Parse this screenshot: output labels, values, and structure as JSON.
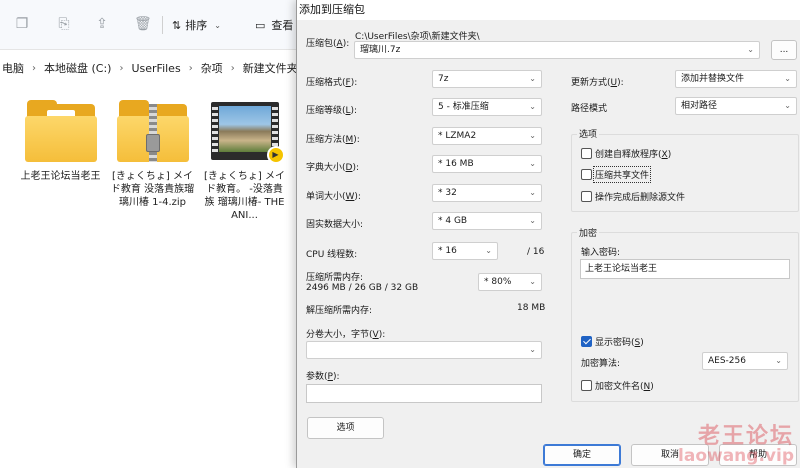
{
  "explorer": {
    "toolbar": {
      "sort_label": "排序",
      "view_label": "查看"
    },
    "breadcrumb": [
      "电脑",
      "本地磁盘 (C:)",
      "UserFiles",
      "杂项",
      "新建文件夹"
    ],
    "files": [
      {
        "name": "上老王论坛当老王",
        "icon": "folder-icon"
      },
      {
        "name": "[きょくちょ] メイド教育 没落貴族瑠璃川椿 1-4.zip",
        "icon": "zip-folder-icon"
      },
      {
        "name": "[きょくちょ] メイド教育。 -没落貴族 瑠璃川椿- THE ANI...",
        "icon": "video-file-icon"
      }
    ]
  },
  "dialog": {
    "title": "添加到压缩包",
    "archive": {
      "label": "压缩包(",
      "label_key": "A",
      "label_end": "):",
      "path": "C:\\UserFiles\\杂项\\新建文件夹\\",
      "name": "瑠璃川.7z",
      "browse_label": "..."
    },
    "left": {
      "format": {
        "label": "压缩格式(",
        "key": "F",
        "end": "):",
        "value": "7z"
      },
      "level": {
        "label": "压缩等级(",
        "key": "L",
        "end": "):",
        "value": "5 - 标准压缩"
      },
      "method": {
        "label": "压缩方法(",
        "key": "M",
        "end": "):",
        "value": "*  LZMA2"
      },
      "dict": {
        "label": "字典大小(",
        "key": "D",
        "end": "):",
        "value": "*  16 MB"
      },
      "word": {
        "label": "单词大小(",
        "key": "W",
        "end": "):",
        "value": "*  32"
      },
      "solid": {
        "label": "固实数据大小:",
        "value": "*  4 GB"
      },
      "threads": {
        "label": "CPU 线程数:",
        "value": "*  16",
        "max": "/ 16"
      },
      "memory": {
        "label": "压缩所需内存:",
        "detail": "2496 MB / 26 GB / 32 GB",
        "value": "* 80%"
      },
      "decomp": {
        "label": "解压缩所需内存:",
        "value": "18 MB"
      },
      "split": {
        "label": "分卷大小，字节(",
        "key": "V",
        "end": "):",
        "value": ""
      },
      "params": {
        "label": "参数(",
        "key": "P",
        "end": "):",
        "value": ""
      },
      "options_button": "选项"
    },
    "right": {
      "update_mode": {
        "label": "更新方式(",
        "key": "U",
        "end": "):",
        "value": "添加并替换文件"
      },
      "path_mode": {
        "label": "路径模式",
        "value": "相对路径"
      },
      "options_group": {
        "title": "选项",
        "sfx": {
          "label": "创建自释放程序(",
          "key": "X",
          "end": ")",
          "checked": false
        },
        "shared": {
          "label": "压缩共享文件",
          "checked": false
        },
        "delete": {
          "label": "操作完成后删除源文件",
          "checked": false
        }
      },
      "encryption_group": {
        "title": "加密",
        "password_label": "输入密码:",
        "password": "上老王论坛当老王",
        "show_password": {
          "label": "显示密码(",
          "key": "S",
          "end": ")",
          "checked": true
        },
        "method_label": "加密算法:",
        "method_value": "AES-256",
        "encrypt_names": {
          "label": "加密文件名(",
          "key": "N",
          "end": ")",
          "checked": false
        }
      }
    },
    "buttons": {
      "ok": "确定",
      "cancel": "取消",
      "help": "帮助"
    }
  },
  "watermark": {
    "main": "老王论坛",
    "sub": "laowang.vip"
  }
}
